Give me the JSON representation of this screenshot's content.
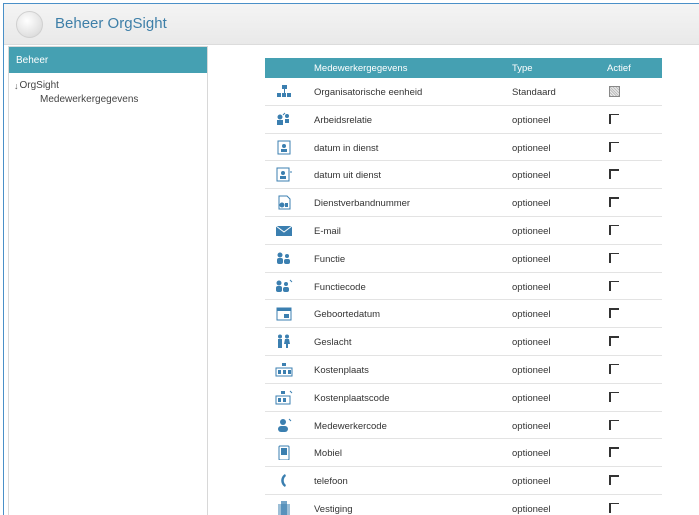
{
  "window": {
    "title": "Beheer OrgSight"
  },
  "sidebar": {
    "header": "Beheer",
    "tree": {
      "root": "OrgSight",
      "child": "Medewerkergegevens"
    }
  },
  "table": {
    "headers": {
      "name": "Medewerkergegevens",
      "type": "Type",
      "active": "Actief"
    },
    "rows": [
      {
        "icon": "org-unit-icon",
        "name": "Organisatorische eenheid",
        "type": "Standaard",
        "active": true
      },
      {
        "icon": "relation-icon",
        "name": "Arbeidsrelatie",
        "type": "optioneel",
        "active": false
      },
      {
        "icon": "start-date-icon",
        "name": "datum in dienst",
        "type": "optioneel",
        "active": false
      },
      {
        "icon": "end-date-icon",
        "name": "datum uit dienst",
        "type": "optioneel",
        "active": false
      },
      {
        "icon": "contract-number-icon",
        "name": "Dienstverbandnummer",
        "type": "optioneel",
        "active": false
      },
      {
        "icon": "email-icon",
        "name": "E-mail",
        "type": "optioneel",
        "active": false
      },
      {
        "icon": "function-icon",
        "name": "Functie",
        "type": "optioneel",
        "active": false
      },
      {
        "icon": "function-code-icon",
        "name": "Functiecode",
        "type": "optioneel",
        "active": false
      },
      {
        "icon": "calendar-icon",
        "name": "Geboortedatum",
        "type": "optioneel",
        "active": false
      },
      {
        "icon": "gender-icon",
        "name": "Geslacht",
        "type": "optioneel",
        "active": false
      },
      {
        "icon": "cost-center-icon",
        "name": "Kostenplaats",
        "type": "optioneel",
        "active": false
      },
      {
        "icon": "cost-center-code-icon",
        "name": "Kostenplaatscode",
        "type": "optioneel",
        "active": false
      },
      {
        "icon": "employee-code-icon",
        "name": "Medewerkercode",
        "type": "optioneel",
        "active": false
      },
      {
        "icon": "mobile-icon",
        "name": "Mobiel",
        "type": "optioneel",
        "active": false
      },
      {
        "icon": "phone-icon",
        "name": "telefoon",
        "type": "optioneel",
        "active": false
      },
      {
        "icon": "location-icon",
        "name": "Vestiging",
        "type": "optioneel",
        "active": false
      }
    ]
  },
  "colors": {
    "accent": "#45a0b2",
    "title": "#3e7fa8",
    "icon": "#3b7fb0"
  }
}
